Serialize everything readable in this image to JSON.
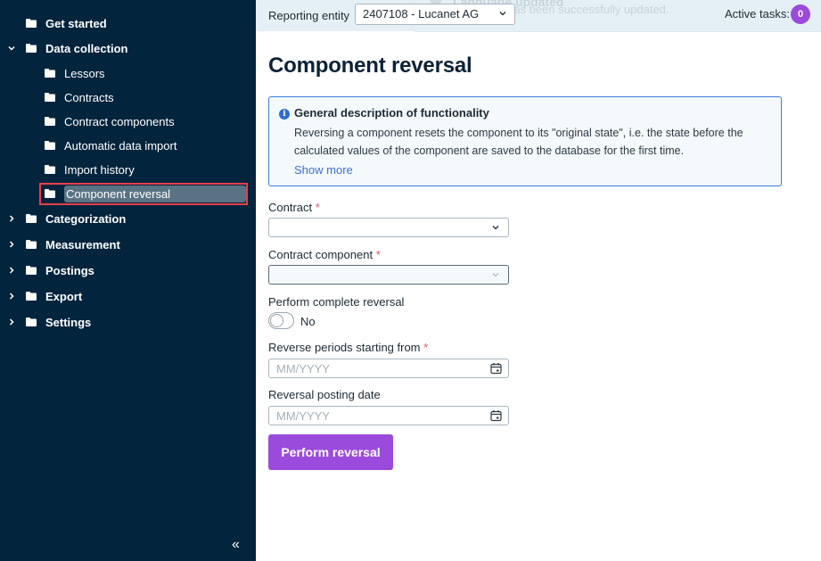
{
  "sidebar": {
    "items": [
      {
        "label": "Get started",
        "level": 0,
        "expandable": false
      },
      {
        "label": "Data collection",
        "level": 0,
        "expandable": true,
        "expanded": true
      },
      {
        "label": "Lessors",
        "level": 1
      },
      {
        "label": "Contracts",
        "level": 1
      },
      {
        "label": "Contract components",
        "level": 1
      },
      {
        "label": "Automatic data import",
        "level": 1
      },
      {
        "label": "Import history",
        "level": 1
      },
      {
        "label": "Component reversal",
        "level": 1,
        "selected": true
      },
      {
        "label": "Categorization",
        "level": 0,
        "expandable": true,
        "expanded": false
      },
      {
        "label": "Measurement",
        "level": 0,
        "expandable": true,
        "expanded": false
      },
      {
        "label": "Postings",
        "level": 0,
        "expandable": true,
        "expanded": false
      },
      {
        "label": "Export",
        "level": 0,
        "expandable": true,
        "expanded": false
      },
      {
        "label": "Settings",
        "level": 0,
        "expandable": true,
        "expanded": false
      }
    ],
    "collapse_icon": "«"
  },
  "header": {
    "reporting_entity_label": "Reporting entity",
    "reporting_entity_value": "2407108 - Lucanet AG",
    "active_tasks_label": "Active tasks:",
    "active_tasks_count": "0",
    "toast": {
      "title": "Language updated",
      "message": "The language has been successfully updated."
    }
  },
  "page": {
    "title": "Component reversal",
    "info": {
      "title": "General description of functionality",
      "text": "Reversing a component resets the component to its \"original state\", i.e. the state before the calculated values of the component are saved to the database for the first time.",
      "show_more": "Show more"
    },
    "form": {
      "contract_label": "Contract",
      "contract_value": "",
      "contract_component_label": "Contract component",
      "contract_component_value": "",
      "complete_reversal_label": "Perform complete reversal",
      "complete_reversal_state": "No",
      "reverse_from_label": "Reverse periods starting from",
      "reverse_from_placeholder": "MM/YYYY",
      "posting_date_label": "Reversal posting date",
      "posting_date_placeholder": "MM/YYYY",
      "required_marker": "*",
      "submit_label": "Perform reversal"
    }
  },
  "colors": {
    "sidebar_bg": "#03243d",
    "accent_purple": "#9a4bdc",
    "info_border": "#3c7be0",
    "selection_outline": "#e4414b",
    "required": "#e05666"
  }
}
